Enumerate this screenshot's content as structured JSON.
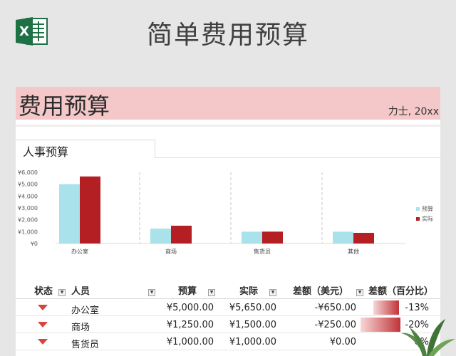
{
  "header": {
    "title": "简单费用预算",
    "logo_letter": "X"
  },
  "banner": {
    "title": "费用预算",
    "subtitle": "力士, 20xx"
  },
  "tab": {
    "label": "人事预算"
  },
  "chart_data": {
    "type": "bar",
    "categories": [
      "办公室",
      "商场",
      "售货员",
      "其他"
    ],
    "series": [
      {
        "name": "预算",
        "values": [
          5000,
          1250,
          1000,
          1000
        ],
        "color": "#a9e2eb"
      },
      {
        "name": "实际",
        "values": [
          5650,
          1500,
          1000,
          900
        ],
        "color": "#b41f23"
      }
    ],
    "ylim": [
      0,
      6000
    ],
    "yticks": [
      "¥6,000",
      "¥5,000",
      "¥4,000",
      "¥3,000",
      "¥2,000",
      "¥1,000",
      "¥0"
    ],
    "legend": "right"
  },
  "table": {
    "headers": {
      "status": "状态",
      "person": "人员",
      "budget": "预算",
      "actual": "实际",
      "diff": "差额（美元）",
      "diff_pct": "差额（百分比）"
    },
    "rows": [
      {
        "person": "办公室",
        "budget": "¥5,000.00",
        "actual": "¥5,650.00",
        "diff": "-¥650.00",
        "pct": "-13%",
        "pct_level": 0.65
      },
      {
        "person": "商场",
        "budget": "¥1,250.00",
        "actual": "¥1,500.00",
        "diff": "-¥250.00",
        "pct": "-20%",
        "pct_level": 1.0
      },
      {
        "person": "售货员",
        "budget": "¥1,000.00",
        "actual": "¥1,000.00",
        "diff": "¥0.00",
        "pct": "0%",
        "pct_level": 0
      }
    ]
  },
  "colors": {
    "banner": "#f4c7c8",
    "accent": "#b41f23",
    "budget": "#a9e2eb"
  }
}
